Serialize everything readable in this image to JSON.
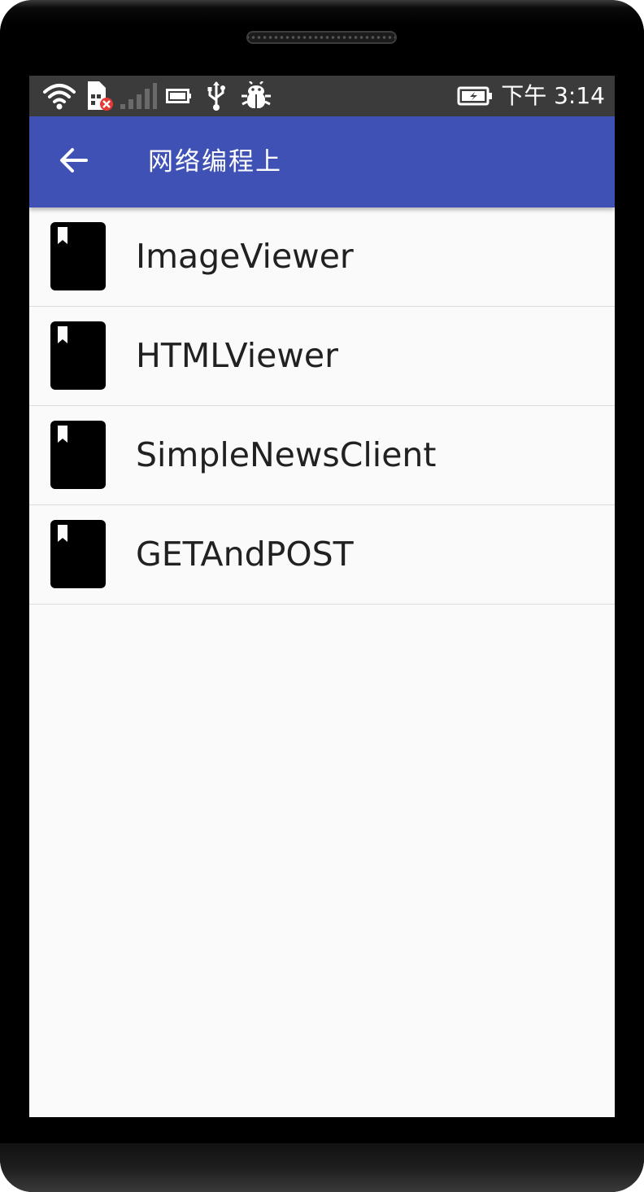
{
  "status_bar": {
    "time": "下午 3:14",
    "icons": [
      "wifi-icon",
      "sim-error-icon",
      "signal-icon",
      "battery-small-icon",
      "usb-icon",
      "debug-bug-icon",
      "battery-charging-icon"
    ]
  },
  "app_bar": {
    "back_icon": "arrow-left-icon",
    "title": "网络编程上",
    "color": "#3f51b5"
  },
  "list": {
    "items": [
      {
        "label": "ImageViewer",
        "icon": "bookmark-book-icon"
      },
      {
        "label": "HTMLViewer",
        "icon": "bookmark-book-icon"
      },
      {
        "label": "SimpleNewsClient",
        "icon": "bookmark-book-icon"
      },
      {
        "label": "GETAndPOST",
        "icon": "bookmark-book-icon"
      }
    ]
  }
}
